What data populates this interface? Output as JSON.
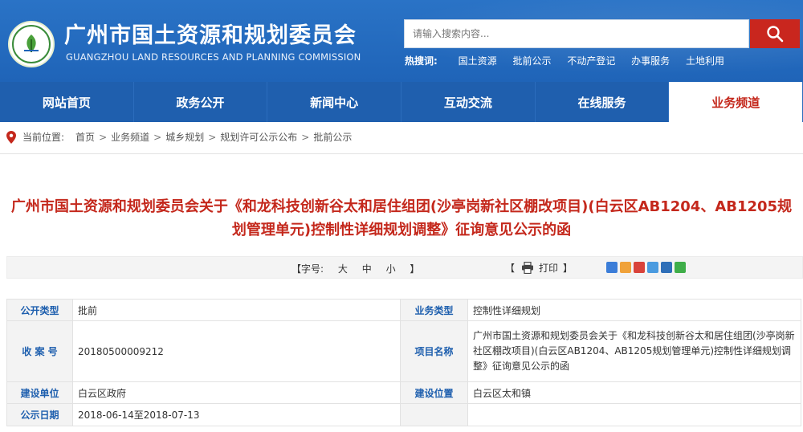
{
  "header": {
    "title": "广州市国土资源和规划委员会",
    "subtitle": "GUANGZHOU LAND RESOURCES AND PLANNING COMMISSION",
    "search_placeholder": "请输入搜索内容...",
    "hot_label": "热搜词:",
    "hot_words": [
      "国土资源",
      "批前公示",
      "不动产登记",
      "办事服务",
      "土地利用"
    ]
  },
  "nav": {
    "items": [
      "网站首页",
      "政务公开",
      "新闻中心",
      "互动交流",
      "在线服务",
      "业务频道"
    ],
    "active_index": 5
  },
  "breadcrumb": {
    "label": "当前位置:",
    "items": [
      "首页",
      "业务频道",
      "城乡规划",
      "规划许可公示公布",
      "批前公示"
    ],
    "separator": ">"
  },
  "article": {
    "title_line1": "广州市国土资源和规划委员会关于《和龙科技创新谷太和居住组团(沙亭岗新社区棚改项目)(白云区AB1204、AB1205规",
    "title_line2": "划管理单元)控制性详细规划调整》征询意见公示的函"
  },
  "tools": {
    "font_label": "【字号:",
    "font_sizes": [
      "大",
      "中",
      "小"
    ],
    "font_end": "】",
    "print_open": "【",
    "print_label": "打印",
    "print_close": "】"
  },
  "info_table": {
    "rows": [
      {
        "k1": "公开类型",
        "v1": "批前",
        "k2": "业务类型",
        "v2": "控制性详细规划"
      },
      {
        "k1": "收 案 号",
        "v1": "20180500009212",
        "k2": "项目名称",
        "v2": "广州市国土资源和规划委员会关于《和龙科技创新谷太和居住组团(沙亭岗新社区棚改项目)(白云区AB1204、AB1205规划管理单元)控制性详细规划调整》征询意见公示的函"
      },
      {
        "k1": "建设单位",
        "v1": "白云区政府",
        "k2": "建设位置",
        "v2": "白云区太和镇"
      },
      {
        "k1": "公示日期",
        "v1": "2018-06-14至2018-07-13",
        "k2": "",
        "v2": ""
      }
    ]
  },
  "colors": {
    "header_blue": "#2a73c6",
    "nav_blue": "#1f5fae",
    "accent_red": "#c4281c",
    "search_button_red": "#c9261e",
    "label_blue": "#1e5fae"
  }
}
